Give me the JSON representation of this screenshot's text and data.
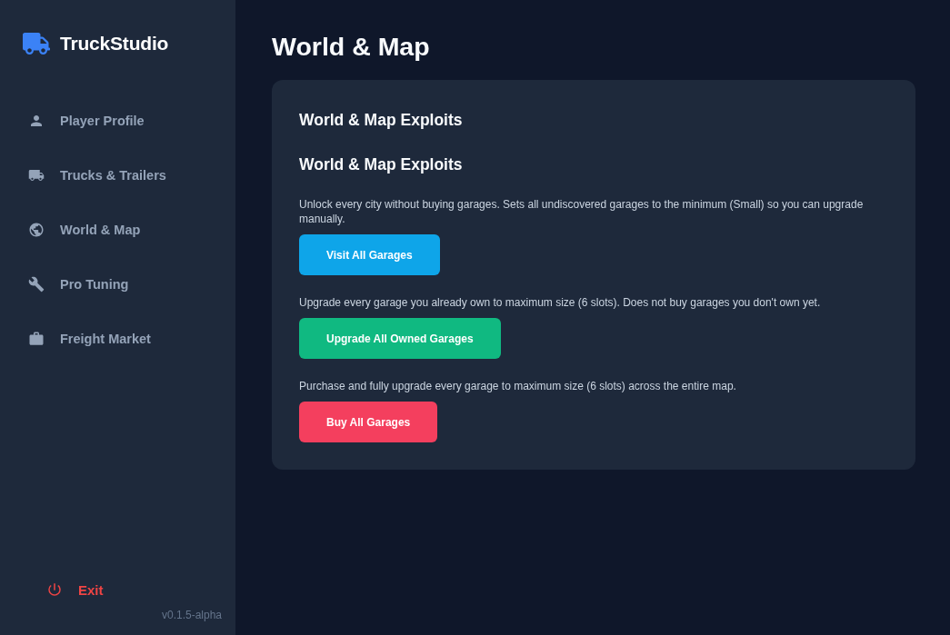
{
  "sidebar": {
    "brand": "TruckStudio",
    "items": [
      {
        "label": "Player Profile"
      },
      {
        "label": "Trucks & Trailers"
      },
      {
        "label": "World & Map"
      },
      {
        "label": "Pro Tuning"
      },
      {
        "label": "Freight Market"
      }
    ],
    "exit": "Exit",
    "version": "v0.1.5-alpha"
  },
  "page": {
    "title": "World & Map",
    "card": {
      "title": "World & Map Exploits",
      "subtitle": "World & Map Exploits",
      "actions": [
        {
          "description": "Unlock every city without buying garages. Sets all undiscovered garages to the minimum (Small) so you can upgrade manually.",
          "button": "Visit All Garages",
          "color": "#0ea5e9"
        },
        {
          "description": "Upgrade every garage you already own to maximum size (6 slots). Does not buy garages you don't own yet.",
          "button": "Upgrade All Owned Garages",
          "color": "#10b981"
        },
        {
          "description": "Purchase and fully upgrade every garage to maximum size (6 slots) across the entire map.",
          "button": "Buy All Garages",
          "color": "#f43f5e"
        }
      ]
    }
  }
}
